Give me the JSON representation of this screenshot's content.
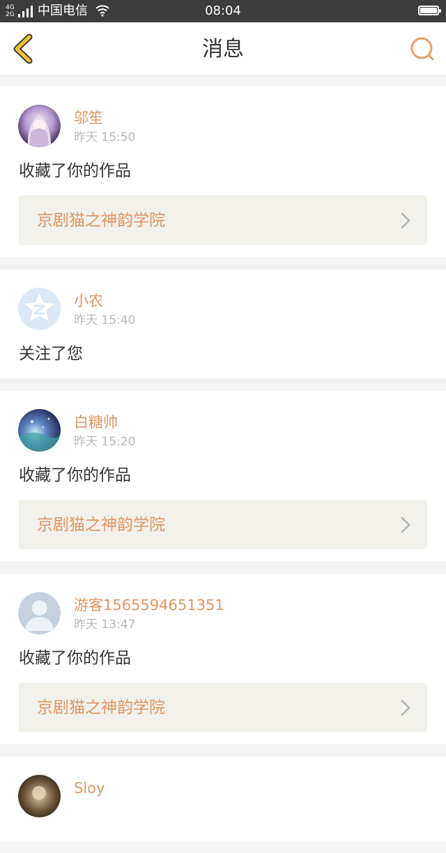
{
  "status_bar": {
    "network_label": "4G¹\n2G",
    "network_top": "4G",
    "network_bottom": "2G",
    "carrier": "中国电信",
    "time": "08:04",
    "battery_level": 1.0,
    "icons": [
      "signal-icon",
      "wifi-icon",
      "battery-icon"
    ]
  },
  "nav": {
    "title": "消息",
    "back_icon": "chevron-left-icon",
    "search_icon": "search-icon",
    "back_color": "#f1c232",
    "search_color": "#ef9d62"
  },
  "colors": {
    "accent": "#e59561",
    "link_bg": "#f2f1ec",
    "page_bg": "#f4f4f4"
  },
  "messages": [
    {
      "user": "邬笙",
      "time": "昨天 15:50",
      "action": "收藏了你的作品",
      "work": "京剧猫之神韵学院",
      "avatar": "anime-girl-avatar"
    },
    {
      "user": "小农",
      "time": "昨天 15:40",
      "action": "关注了您",
      "work": null,
      "avatar": "qzone-default-avatar"
    },
    {
      "user": "白糖帅",
      "time": "昨天 15:20",
      "action": "收藏了你的作品",
      "work": "京剧猫之神韵学院",
      "avatar": "galaxy-avatar"
    },
    {
      "user": "游客1565594651351",
      "time": "昨天 13:47",
      "action": "收藏了你的作品",
      "work": "京剧猫之神韵学院",
      "avatar": "default-person-avatar"
    },
    {
      "user": "Sloy",
      "time": "",
      "action": "",
      "work": null,
      "avatar": "photo-avatar"
    }
  ]
}
